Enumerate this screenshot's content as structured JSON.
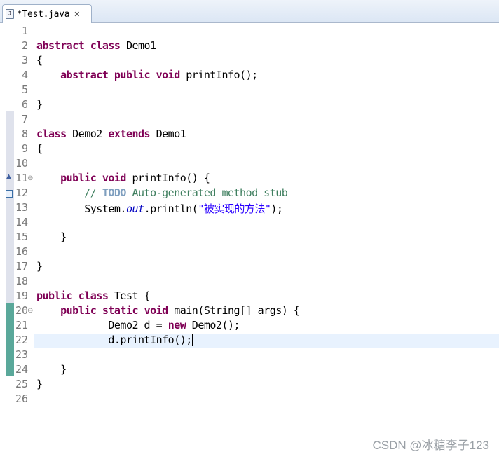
{
  "tab": {
    "icon": "java-file-icon",
    "title": "*Test.java",
    "close": "✕"
  },
  "lines": [
    {
      "n": "1"
    },
    {
      "n": "2"
    },
    {
      "n": "3"
    },
    {
      "n": "4"
    },
    {
      "n": "5"
    },
    {
      "n": "6"
    },
    {
      "n": "7"
    },
    {
      "n": "8"
    },
    {
      "n": "9"
    },
    {
      "n": "10"
    },
    {
      "n": "11"
    },
    {
      "n": "12"
    },
    {
      "n": "13"
    },
    {
      "n": "14"
    },
    {
      "n": "15"
    },
    {
      "n": "16"
    },
    {
      "n": "17"
    },
    {
      "n": "18"
    },
    {
      "n": "19"
    },
    {
      "n": "20"
    },
    {
      "n": "21"
    },
    {
      "n": "22"
    },
    {
      "n": "23"
    },
    {
      "n": "24"
    },
    {
      "n": "25"
    },
    {
      "n": "26"
    }
  ],
  "code": {
    "l2": {
      "k1": "abstract",
      "k2": "class",
      "t": " Demo1"
    },
    "l3": "{",
    "l4": {
      "indent": "    ",
      "k1": "abstract",
      "k2": "public",
      "k3": "void",
      "t": " printInfo();"
    },
    "l6": "}",
    "l8": {
      "k1": "class",
      "t1": " Demo2 ",
      "k2": "extends",
      "t2": " Demo1"
    },
    "l9": "{",
    "l11": {
      "indent": "    ",
      "k1": "public",
      "k2": "void",
      "t": " printInfo() {"
    },
    "l12": {
      "indent": "        ",
      "c1": "// ",
      "todo": "TODO",
      "c2": " Auto-generated method stub"
    },
    "l13": {
      "indent": "        ",
      "t1": "System.",
      "stat": "out",
      "t2": ".println(",
      "str": "\"被实现的方法\"",
      "t3": ");"
    },
    "l15": "    }",
    "l17": "}",
    "l19": {
      "k1": "public",
      "k2": "class",
      "t": " Test {"
    },
    "l20": {
      "indent": "    ",
      "k1": "public",
      "k2": "static",
      "k3": "void",
      "t": " main(String[] args) {"
    },
    "l21": {
      "indent": "            ",
      "t1": "Demo2 d = ",
      "k1": "new",
      "t2": " Demo2();"
    },
    "l22": {
      "indent": "            ",
      "t": "d.printInfo();"
    },
    "l24": "    }",
    "l25": "}"
  },
  "watermark": "CSDN @冰糖李子123",
  "colors": {
    "keyword": "#7f0055",
    "comment": "#3f7f5f",
    "string": "#2a00ff",
    "current_line": "#e8f2fe",
    "change_bar": "#d8dde8",
    "added_bar": "#5aa89a"
  }
}
